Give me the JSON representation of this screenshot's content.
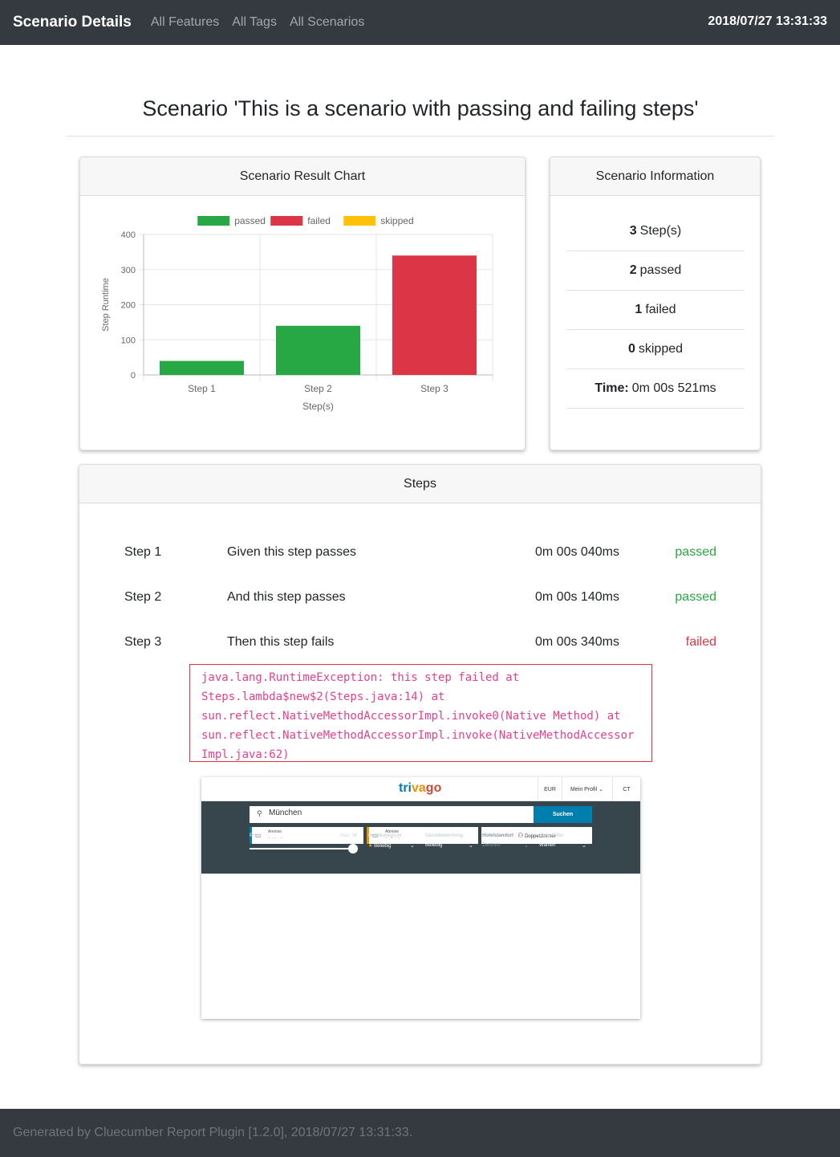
{
  "nav": {
    "brand": "Scenario Details",
    "links": [
      "All Features",
      "All Tags",
      "All Scenarios"
    ],
    "datetime": "2018/07/27 13:31:33"
  },
  "page": {
    "title": "Scenario 'This is a scenario with passing and failing steps'"
  },
  "colors": {
    "passed": "#28a745",
    "failed": "#dc3545",
    "skipped": "#ffc107",
    "navbar": "#343a40"
  },
  "chart_card": {
    "header": "Scenario Result Chart"
  },
  "chart_data": {
    "type": "bar",
    "categories": [
      "Step 1",
      "Step 2",
      "Step 3"
    ],
    "series": [
      {
        "name": "passed",
        "values": [
          40,
          140,
          0
        ]
      },
      {
        "name": "failed",
        "values": [
          0,
          0,
          340
        ]
      },
      {
        "name": "skipped",
        "values": [
          0,
          0,
          0
        ]
      }
    ],
    "xlabel": "Step(s)",
    "ylabel": "Step Runtime",
    "ylim": [
      0,
      400
    ],
    "yticks": [
      0,
      100,
      200,
      300,
      400
    ],
    "grid": true,
    "legend": "top-center"
  },
  "info_card": {
    "header": "Scenario Information",
    "rows": [
      {
        "value": "3",
        "label": "Step(s)"
      },
      {
        "value": "2",
        "label": "passed"
      },
      {
        "value": "1",
        "label": "failed"
      },
      {
        "value": "0",
        "label": "skipped"
      },
      {
        "value": "Time:",
        "label": "0m 00s 521ms"
      }
    ]
  },
  "steps_card": {
    "header": "Steps",
    "steps": [
      {
        "step": "Step 1",
        "name": "Given this step passes",
        "time": "0m 00s 040ms",
        "status": "passed"
      },
      {
        "step": "Step 2",
        "name": "And this step passes",
        "time": "0m 00s 140ms",
        "status": "passed"
      },
      {
        "step": "Step 3",
        "name": "Then this step fails",
        "time": "0m 00s 340ms",
        "status": "failed"
      }
    ],
    "error_lines": [
      "java.lang.RuntimeException: this step failed at",
      "Steps.lambda$new$2(Steps.java:14) at",
      "sun.reflect.NativeMethodAccessorImpl.invoke0(Native Method) at",
      "sun.reflect.NativeMethodAccessorImpl.invoke(NativeMethodAccessor",
      "Impl.java:62)"
    ]
  },
  "screenshot": {
    "logo": [
      "tri",
      "va",
      "go"
    ],
    "currency": "EUR",
    "profile": "Mein Profil",
    "ct": "CT",
    "search_value": "München",
    "search_button": "Suchen",
    "arrival_label": "Anreise",
    "departure_label": "Abreise",
    "date_placeholder": "-- . -- . --",
    "room": "Doppelzimmer",
    "filters": [
      {
        "label": "Preis",
        "value": ""
      },
      {
        "label": "Hotelkategorie",
        "value": "Beliebig"
      },
      {
        "label": "Gästebewertung",
        "value": "Beliebig"
      },
      {
        "label": "Hotelstandort",
        "value": "Zentrum"
      },
      {
        "label": "Mehr Filter",
        "value": "Wählen"
      }
    ],
    "price_max": "max. 0€"
  },
  "footer": {
    "text": "Generated by Cluecumber Report Plugin [1.2.0], 2018/07/27 13:31:33."
  }
}
